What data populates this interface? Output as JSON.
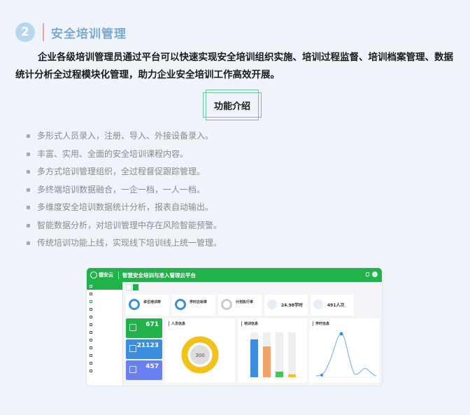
{
  "section": {
    "number": "2",
    "title": "安全培训管理",
    "intro": "企业各级培训管理员通过平台可以快速实现安全培训组织实施、培训过程监督、培训档案管理、数据统计分析全过程模块化管理，助力企业安全培训工作高效开展。",
    "feature_label": "功能介绍",
    "features": [
      "多形式人员录入，注册、导入、外接设备录入。",
      "丰富、实用、全面的安全培训课程内容。",
      "多方式培训管理组织，全过程督促跟踪管理。",
      "多终端培训数据融合，一企一档，一人一档。",
      "多维度安全培训数据统计分析，报表自动输出。",
      "智能数据分析，对培训管理中存在风险智能预警。",
      "传统培训功能上线，实现线下培训线上统一管理。"
    ]
  },
  "app": {
    "logo_text": "德安云",
    "title": "智慧安全培训与准入管理云平台",
    "colors": {
      "primary": "#22b24c",
      "blue": "#3b8de0",
      "yellow": "#f2c21b",
      "orange": "#f4a26b"
    },
    "stats": [
      {
        "title": "单位培训率"
      },
      {
        "title": "学时达标率"
      },
      {
        "title": "计划执行率"
      },
      {
        "value": "24.98学时"
      },
      {
        "value": "491人次"
      }
    ],
    "cards": [
      {
        "value": "671",
        "color": "#22b24c"
      },
      {
        "value": "21123",
        "color": "#3b8de0"
      },
      {
        "value": "457",
        "color": "#6a7ff0"
      }
    ],
    "panels": {
      "people": {
        "title": "人员信息",
        "center_value": "300"
      },
      "training": {
        "title": "培训信息"
      },
      "hours": {
        "title": "学时信息"
      }
    }
  }
}
